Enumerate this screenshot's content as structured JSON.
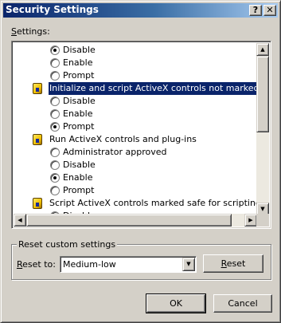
{
  "window": {
    "title": "Security Settings"
  },
  "titlebar": {
    "help_label": "?",
    "close_label": "✕"
  },
  "settings": {
    "label": "Settings:",
    "rows": [
      {
        "kind": "option",
        "label": "Disable",
        "checked": true
      },
      {
        "kind": "option",
        "label": "Enable",
        "checked": false
      },
      {
        "kind": "option",
        "label": "Prompt",
        "checked": false
      },
      {
        "kind": "group",
        "label": "Initialize and script ActiveX controls not marked as safe",
        "selected": true
      },
      {
        "kind": "option",
        "label": "Disable",
        "checked": false
      },
      {
        "kind": "option",
        "label": "Enable",
        "checked": false
      },
      {
        "kind": "option",
        "label": "Prompt",
        "checked": true
      },
      {
        "kind": "group",
        "label": "Run ActiveX controls and plug-ins",
        "selected": false
      },
      {
        "kind": "option",
        "label": "Administrator approved",
        "checked": false
      },
      {
        "kind": "option",
        "label": "Disable",
        "checked": false
      },
      {
        "kind": "option",
        "label": "Enable",
        "checked": true
      },
      {
        "kind": "option",
        "label": "Prompt",
        "checked": false
      },
      {
        "kind": "group",
        "label": "Script ActiveX controls marked safe for scripting",
        "selected": false
      },
      {
        "kind": "option",
        "label": "Disable",
        "checked": false
      }
    ],
    "scroll_up_label": "▲",
    "scroll_down_label": "▼",
    "scroll_left_label": "◀",
    "scroll_right_label": "▶"
  },
  "reset": {
    "group_title": "Reset custom settings",
    "reset_to_prefix": "",
    "reset_to_mnemonic": "R",
    "reset_to_rest": "eset to:",
    "selected_level": "Medium-low",
    "dropdown_arrow": "▼",
    "reset_button_mnemonic": "R",
    "reset_button_rest": "eset"
  },
  "footer": {
    "ok_label": "OK",
    "cancel_label": "Cancel"
  }
}
